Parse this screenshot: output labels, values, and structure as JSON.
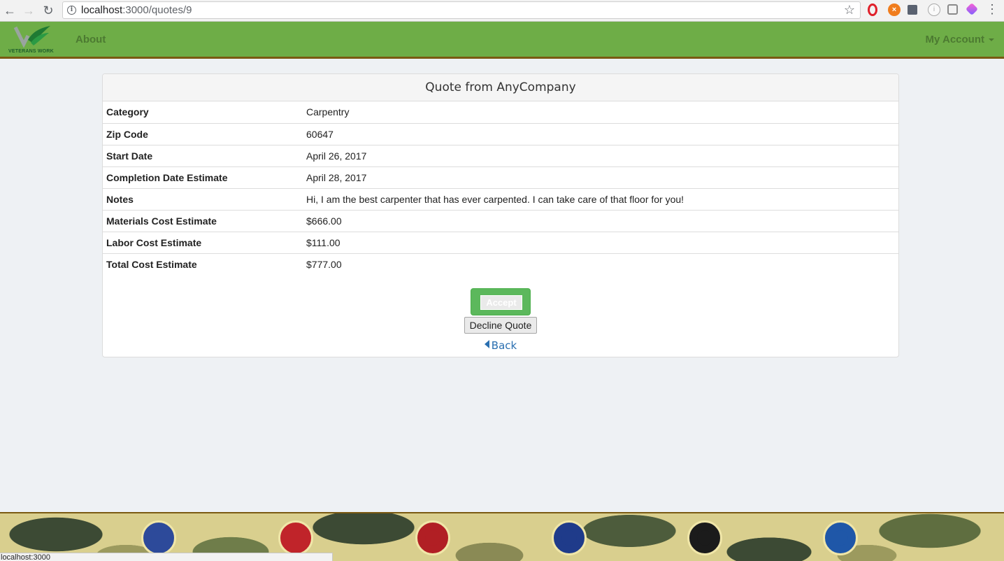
{
  "browser": {
    "url_host": "localhost",
    "url_path": ":3000/quotes/9",
    "status_text": "localhost:3000"
  },
  "navbar": {
    "logo_text": "VETERANS WORK",
    "about_label": "About",
    "account_label": "My Account"
  },
  "quote": {
    "title": "Quote from AnyCompany",
    "rows": [
      {
        "label": "Category",
        "value": "Carpentry"
      },
      {
        "label": "Zip Code",
        "value": "60647"
      },
      {
        "label": "Start Date",
        "value": "April 26, 2017"
      },
      {
        "label": "Completion Date Estimate",
        "value": "April 28, 2017"
      },
      {
        "label": "Notes",
        "value": "Hi, I am the best carpenter that has ever carpented. I can take care of that floor for you!"
      },
      {
        "label": "Materials Cost Estimate",
        "value": "$666.00"
      },
      {
        "label": "Labor Cost Estimate",
        "value": "$111.00"
      },
      {
        "label": "Total Cost Estimate",
        "value": "$777.00"
      }
    ],
    "accept_label": "Accept",
    "decline_label": "Decline Quote",
    "back_label": "Back"
  },
  "footer": {
    "seals": [
      {
        "name": "air-force-seal",
        "color": "#2d4a9a"
      },
      {
        "name": "national-guard-seal",
        "color": "#c0242a"
      },
      {
        "name": "marine-corps-seal",
        "color": "#b11f24"
      },
      {
        "name": "navy-seal",
        "color": "#1f3b8a"
      },
      {
        "name": "army-seal",
        "color": "#1b1b1b"
      },
      {
        "name": "coast-guard-seal",
        "color": "#1f57a8"
      }
    ]
  },
  "colors": {
    "navbar_green": "#6ead47",
    "accept_green": "#5cb85c",
    "link_blue": "#2a6fb0"
  }
}
